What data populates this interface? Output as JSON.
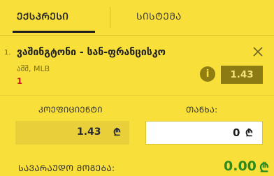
{
  "tabs": {
    "express": "ᲔᲥᲡᲞᲠᲔᲡᲘ",
    "system": "ᲡᲘᲡᲢᲔᲛᲐ"
  },
  "bet": {
    "index": "1.",
    "match": "ვაშინგტონი - სან-ფრანცისკო",
    "league": "აშშ, MLB",
    "pick": "1",
    "odds": "1.43",
    "info_symbol": "i"
  },
  "form": {
    "coef_label": "ᲙᲝᲔᲤᲘᲪᲘᲔᲜᲢᲘ",
    "coef_value": "1.43",
    "amount_label": "ᲗᲐᲜᲮᲐ:",
    "amount_value": "0",
    "currency": "₾"
  },
  "payout": {
    "label": "ᲡᲐᲕᲐᲠᲐᲣᲓᲝ ᲛᲝᲒᲔᲑᲐ:",
    "value": "0.00",
    "currency": "₾"
  },
  "colors": {
    "background": "#f9df3a",
    "odds_box": "#8c7b12",
    "pick_red": "#c2171c",
    "payout_green": "#2a8a1e"
  }
}
